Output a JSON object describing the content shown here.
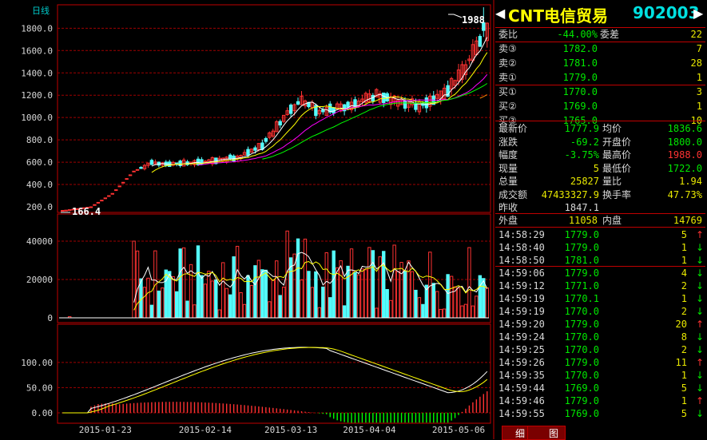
{
  "header": {
    "arrow_left": "◀",
    "stock_name": "CNT电信贸易",
    "stock_code": "902003",
    "arrow_right": "▶"
  },
  "colors": {
    "up": "#ff3232",
    "down": "#54fcfc",
    "flat": "#d8d8d8",
    "border": "#c00000",
    "grid": "#a00000",
    "label": "#d8d8d8",
    "yellow": "#e8e800",
    "green_val": "#00e800",
    "code": "#00e0e0",
    "ma5": "#ffffff",
    "ma10": "#ffff00",
    "ma20": "#ff00ff",
    "ma30": "#00ff00",
    "ma60": "#ff8000"
  },
  "order_book": [
    {
      "label": "委比",
      "value": "-44.00%",
      "label2": "委差",
      "value2": "22"
    },
    {
      "label": "卖③",
      "price": "1782.0",
      "vol": "7"
    },
    {
      "label": "卖②",
      "price": "1781.0",
      "vol": "28"
    },
    {
      "label": "卖①",
      "price": "1779.0",
      "vol": "1"
    },
    {
      "label": "买①",
      "price": "1770.0",
      "vol": "3"
    },
    {
      "label": "买②",
      "price": "1769.0",
      "vol": "1"
    },
    {
      "label": "买③",
      "price": "1765.0",
      "vol": "10"
    }
  ],
  "quote": [
    {
      "l1": "最新价",
      "v1": "1777.9",
      "c1": "green",
      "l2": "均价",
      "v2": "1836.6",
      "c2": "green"
    },
    {
      "l1": "涨跌",
      "v1": "-69.2",
      "c1": "green",
      "l2": "开盘价",
      "v2": "1800.0",
      "c2": "green"
    },
    {
      "l1": "幅度",
      "v1": "-3.75%",
      "c1": "green",
      "l2": "最高价",
      "v2": "1988.0",
      "c2": "red"
    },
    {
      "l1": "现量",
      "v1": "5",
      "c1": "yellow",
      "l2": "最低价",
      "v2": "1722.0",
      "c2": "green"
    },
    {
      "l1": "总量",
      "v1": "25827",
      "c1": "yellow",
      "l2": "量比",
      "v2": "1.94",
      "c2": "yellow"
    },
    {
      "l1": "成交额",
      "v1": "47433327.9",
      "c1": "yellow",
      "l2": "换手率",
      "v2": "47.73%",
      "c2": "yellow"
    },
    {
      "l1": "昨收",
      "v1": "1847.1",
      "c1": "gray",
      "l2": "",
      "v2": "",
      "c2": "gray"
    }
  ],
  "outer_inner": {
    "outer_label": "外盘",
    "outer_value": "11058",
    "inner_label": "内盘",
    "inner_value": "14769"
  },
  "ticks": [
    {
      "time": "14:58:29",
      "price": "1779.0",
      "vol": "5",
      "dir": "up"
    },
    {
      "time": "14:58:40",
      "price": "1779.0",
      "vol": "1",
      "dir": "down"
    },
    {
      "time": "14:58:50",
      "price": "1781.0",
      "vol": "1",
      "dir": "down"
    },
    {
      "time": "14:59:06",
      "price": "1779.0",
      "vol": "4",
      "dir": "down"
    },
    {
      "time": "14:59:12",
      "price": "1771.0",
      "vol": "2",
      "dir": "down"
    },
    {
      "time": "14:59:19",
      "price": "1770.1",
      "vol": "1",
      "dir": "down"
    },
    {
      "time": "14:59:19",
      "price": "1770.0",
      "vol": "2",
      "dir": "down"
    },
    {
      "time": "14:59:20",
      "price": "1779.0",
      "vol": "20",
      "dir": "up"
    },
    {
      "time": "14:59:24",
      "price": "1770.0",
      "vol": "8",
      "dir": "down"
    },
    {
      "time": "14:59:25",
      "price": "1770.0",
      "vol": "2",
      "dir": "down"
    },
    {
      "time": "14:59:26",
      "price": "1779.0",
      "vol": "11",
      "dir": "up"
    },
    {
      "time": "14:59:35",
      "price": "1770.0",
      "vol": "1",
      "dir": "down"
    },
    {
      "time": "14:59:44",
      "price": "1769.0",
      "vol": "5",
      "dir": "down"
    },
    {
      "time": "14:59:46",
      "price": "1779.0",
      "vol": "1",
      "dir": "up"
    },
    {
      "time": "14:59:55",
      "price": "1769.0",
      "vol": "5",
      "dir": "down"
    }
  ],
  "bottom_tabs": [
    "细",
    "图"
  ],
  "chart_data": {
    "type": "candlestick",
    "title": "日线",
    "price_axis": {
      "ticks": [
        "1800.0",
        "1600.0",
        "1400.0",
        "1200.0",
        "1000.0",
        "800.0",
        "600.0",
        "400.0",
        "200.0"
      ],
      "min": 150,
      "max": 2010
    },
    "volume_axis": {
      "ticks": [
        "40000",
        "20000",
        "0"
      ],
      "max": 50000
    },
    "indicator_axis": {
      "ticks": [
        "100.00",
        "50.00",
        "0.00"
      ],
      "min": -8,
      "max": 160
    },
    "x_labels": [
      "2015-01-23",
      "2015-02-14",
      "2015-03-13",
      "2015-04-04",
      "2015-05-06"
    ],
    "annotations": {
      "high_label": "1988",
      "low_label": "166.4"
    },
    "ohlc": [],
    "volumes": [],
    "ma": {},
    "indicator": {}
  }
}
